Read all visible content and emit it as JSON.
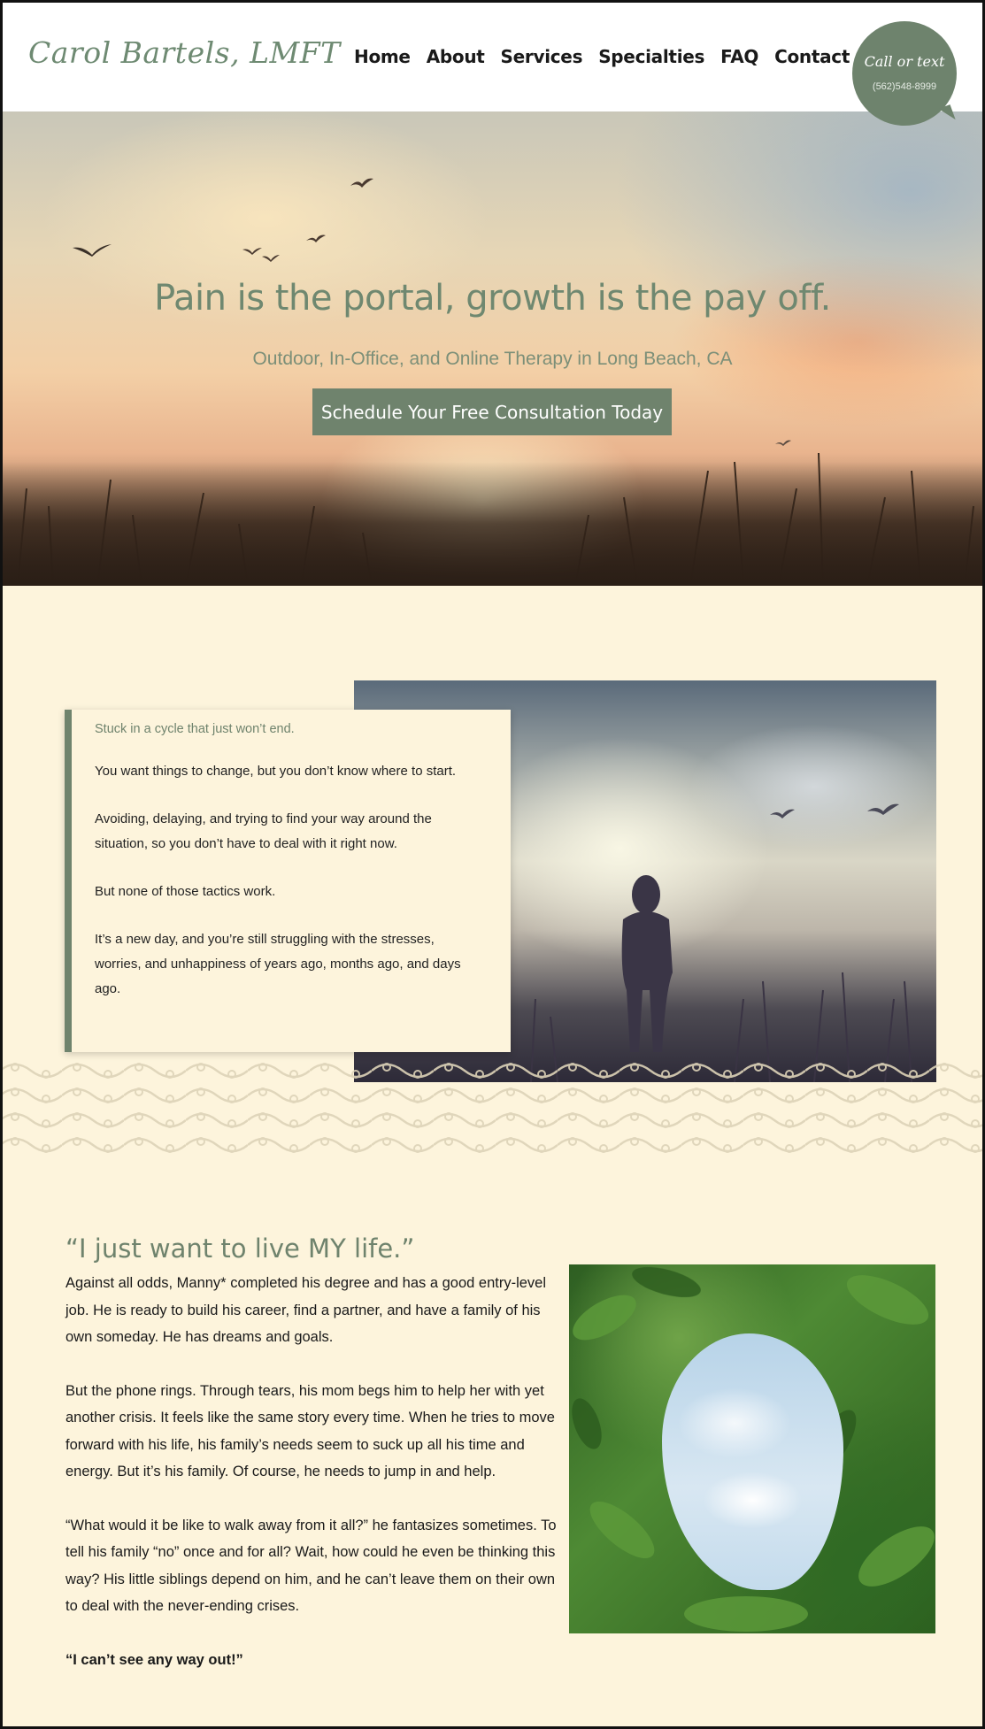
{
  "header": {
    "logo": "Carol Bartels, LMFT",
    "nav": [
      "Home",
      "About",
      "Services",
      "Specialties",
      "FAQ",
      "Contact"
    ],
    "bubble_title": "Call or text",
    "bubble_phone": "(562)548-8999"
  },
  "hero": {
    "headline": "Pain is the portal, growth is the pay off.",
    "subheading": "Outdoor, In-Office, and Online Therapy in Long Beach, CA",
    "cta": "Schedule Your Free Consultation Today"
  },
  "cycle": {
    "lead": "Stuck in a cycle that just won’t end.",
    "paragraphs": [
      "You want things to change, but you don’t know where to start.",
      "Avoiding, delaying, and trying to find your way around the situation, so you don’t have to deal with it right now.",
      "But none of those tactics work.",
      "It’s a new day, and you’re still struggling with the stresses, worries, and unhappiness of years ago, months ago, and days ago."
    ]
  },
  "story": {
    "title": "“I just want to live MY life.”",
    "paragraphs": [
      "Against all odds, Manny* completed his degree and has a good entry-level job. He is ready to build his career, find a partner, and have a family of his own someday. He has dreams and goals.",
      "But the phone rings. Through tears, his mom begs him to help her with yet another crisis. It feels like the same story every time. When he tries to move forward with his life, his family’s needs seem to suck up all his time and energy. But it’s his family. Of course, he needs to jump in and help.",
      "“What would it be like to walk away from it all?” he fantasizes sometimes. To tell his family “no” once and for all? Wait, how could he even be thinking this way? His little siblings depend on him, and he can’t leave them on their own to deal with the never-ending crises."
    ],
    "closing": "“I can’t see any way out!”"
  },
  "colors": {
    "accent": "#6f836d",
    "background": "#fdf4dc"
  }
}
